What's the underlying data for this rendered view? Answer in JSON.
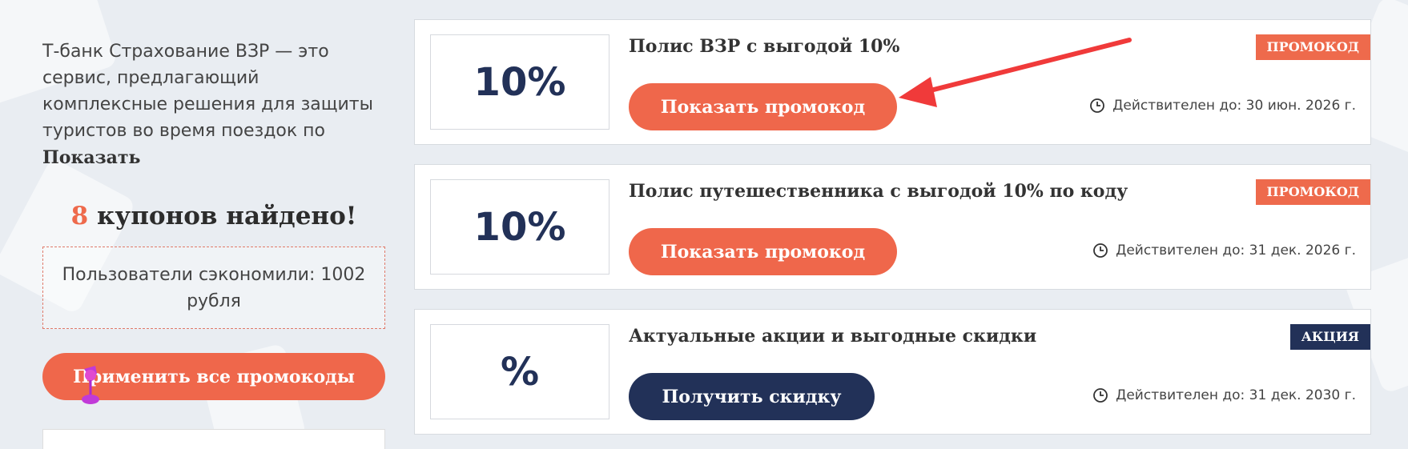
{
  "sidebar": {
    "description": "Т-банк Страхование ВЗР — это сервис, предлагающий комплексные решения для защиты туристов во время поездок по",
    "show_more_label": "Показать",
    "found_count": "8",
    "found_text": " купонов найдено!",
    "saved_text": "Пользователи сэкономили: 1002 рубля",
    "apply_all_label": "Применить все промокоды"
  },
  "coupons": [
    {
      "discount": "10%",
      "title": "Полис ВЗР с выгодой 10%",
      "badge": "ПРОМОКОД",
      "button_label": "Показать промокод",
      "valid_text": "Действителен до: 30 июн. 2026 г."
    },
    {
      "discount": "10%",
      "title": "Полис путешественника с выгодой 10% по коду",
      "badge": "ПРОМОКОД",
      "button_label": "Показать промокод",
      "valid_text": "Действителен до: 31 дек. 2026 г."
    },
    {
      "discount": "%",
      "title": "Актуальные акции и выгодные скидки",
      "badge": "АКЦИЯ",
      "button_label": "Получить скидку",
      "valid_text": "Действителен до: 31 дек. 2030 г."
    }
  ],
  "colors": {
    "accent": "#ef674b",
    "navy": "#223158",
    "annotation_arrow": "#f03a3a",
    "cursor": "#c13ad8"
  },
  "icons": {
    "clock": "clock-icon",
    "arrow": "red-arrow-annotation",
    "cursor": "cursor-pointer-icon"
  }
}
